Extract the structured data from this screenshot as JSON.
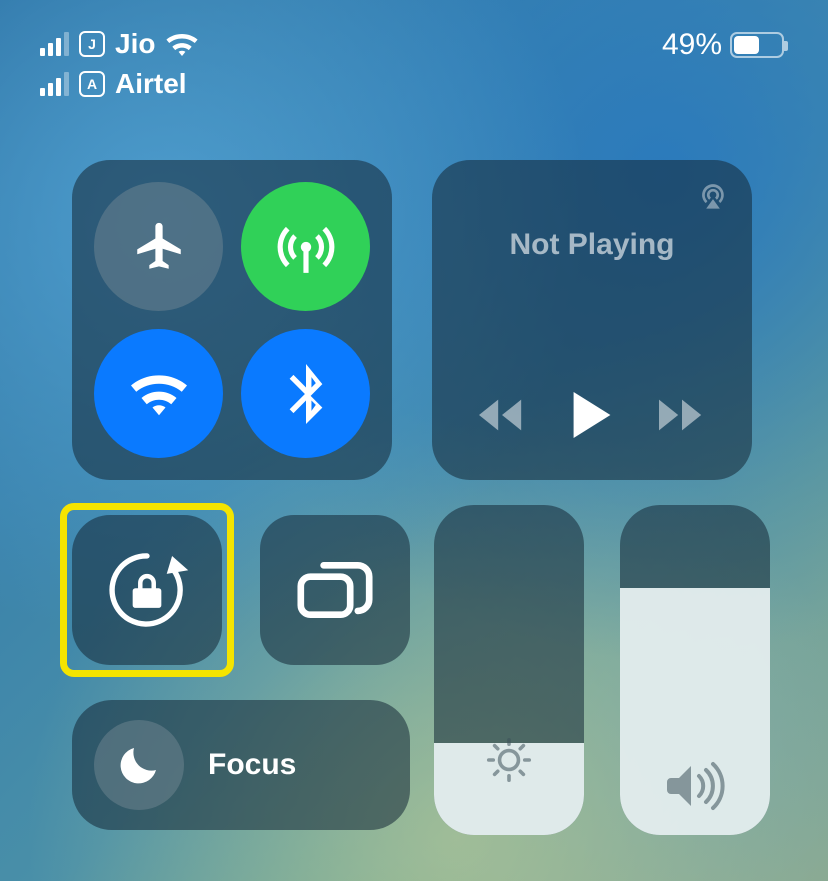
{
  "status": {
    "sim1": {
      "letter": "J",
      "carrier": "Jio"
    },
    "sim2": {
      "letter": "A",
      "carrier": "Airtel"
    },
    "battery_percent_text": "49%",
    "battery_fill_percent": 49
  },
  "connectivity": {
    "airplane_on": false,
    "cellular_on": true,
    "wifi_on": true,
    "bluetooth_on": true
  },
  "music": {
    "status_text": "Not Playing"
  },
  "focus": {
    "label": "Focus"
  },
  "sliders": {
    "brightness_percent": 28,
    "volume_percent": 75
  },
  "colors": {
    "accent_green": "#30d158",
    "accent_blue": "#0a7aff",
    "highlight": "#f5e400"
  }
}
